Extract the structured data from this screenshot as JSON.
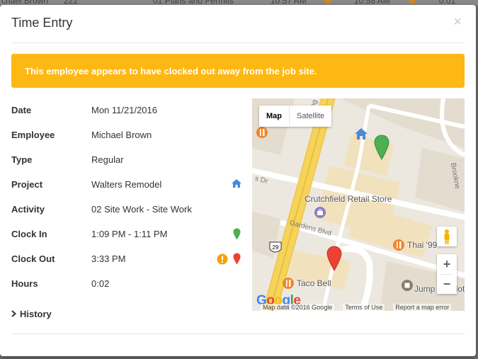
{
  "background": {
    "row_texts": [
      "chael Brown",
      "222",
      "01 Plans and Permits",
      "10:57 AM",
      "10:58 AM",
      "0:01"
    ]
  },
  "modal": {
    "title": "Time Entry",
    "close_label": "×"
  },
  "alert": {
    "message": "This employee appears to have clocked out away from the job site.",
    "color": "#fdb813"
  },
  "details": {
    "date_label": "Date",
    "date_value": "Mon 11/21/2016",
    "employee_label": "Employee",
    "employee_value": "Michael Brown",
    "type_label": "Type",
    "type_value": "Regular",
    "project_label": "Project",
    "project_value": "Walters Remodel",
    "project_icon": "home-icon",
    "activity_label": "Activity",
    "activity_value": "02 Site Work - Site Work",
    "clock_in_label": "Clock In",
    "clock_in_value": "1:09 PM - 1:11 PM",
    "clock_in_icon": "green-map-pin-icon",
    "clock_out_label": "Clock Out",
    "clock_out_value": "3:33 PM",
    "clock_out_icons": [
      "warning-icon",
      "red-map-pin-icon"
    ],
    "hours_label": "Hours",
    "hours_value": "0:02"
  },
  "history": {
    "label": "History"
  },
  "map": {
    "type_map": "Map",
    "type_satellite": "Satellite",
    "zoom_in": "+",
    "zoom_out": "−",
    "places": {
      "crutchfield": "Crutchfield Retail Store",
      "thai": "Thai '99",
      "taco_bell": "Taco Bell",
      "jump": "Jump Charlottesv"
    },
    "roads": {
      "gardens": "Gardens Blvd",
      "dr": "s Dr",
      "brookne": "Brookne",
      "route": "29",
      "partial": "og"
    },
    "google": "Google",
    "attribution": {
      "data": "Map data ©2016 Google",
      "terms": "Terms of Use",
      "report": "Report a map error"
    },
    "colors": {
      "green_pin": "#4caf50",
      "red_pin": "#ea4335",
      "home": "#4a89dc",
      "warning": "#f0a30a",
      "poi_food": "#f0842a",
      "road_major": "#f6d35a"
    }
  }
}
